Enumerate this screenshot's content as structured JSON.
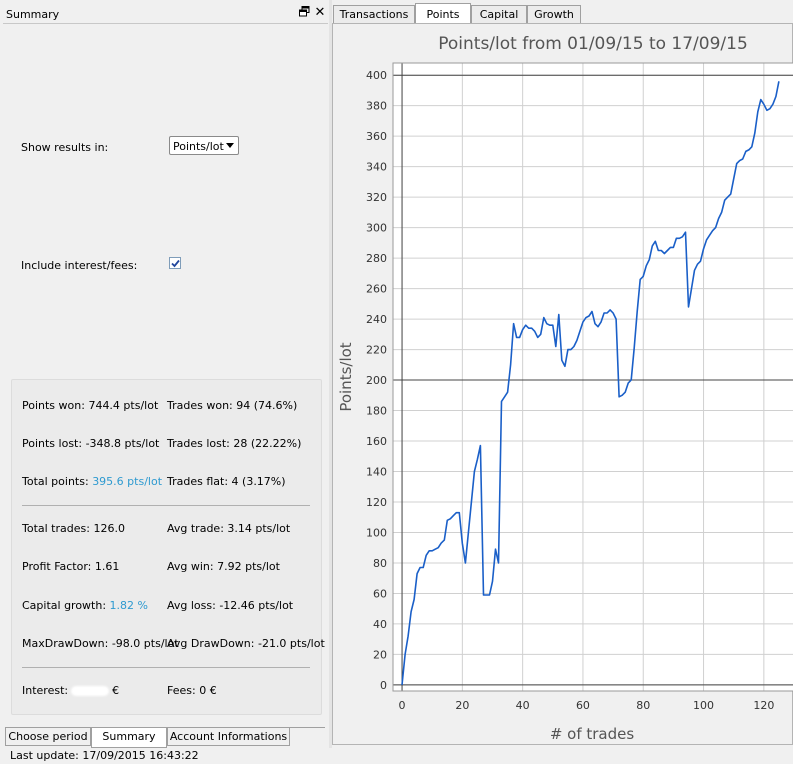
{
  "window": {
    "panel_title": "Summary",
    "status": "Last update: 17/09/2015 16:43:22"
  },
  "options": {
    "show_results_label": "Show results in:",
    "units_value": "Points/lot",
    "include_label": "Include interest/fees:",
    "include_checked": true
  },
  "stats": {
    "points_won": "Points won: 744.4 pts/lot",
    "points_lost": "Points lost: -348.8 pts/lot",
    "total_points_label": "Total points: ",
    "total_points_value": "395.6 pts/lot",
    "trades_won": "Trades won: 94 (74.6%)",
    "trades_lost": "Trades lost: 28 (22.22%)",
    "trades_flat": "Trades flat: 4 (3.17%)",
    "total_trades": "Total trades: 126.0",
    "profit_factor": "Profit Factor: 1.61",
    "capital_growth_label": "Capital growth: ",
    "capital_growth_value": "1.82 %",
    "max_drawdown": "MaxDrawDown: -98.0 pts/lot",
    "avg_trade": "Avg trade: 3.14 pts/lot",
    "avg_win": "Avg win: 7.92 pts/lot",
    "avg_loss": "Avg loss: -12.46 pts/lot",
    "avg_drawdown": "Avg DrawDown: -21.0 pts/lot",
    "interest_label": "Interest:",
    "interest_unit": "€",
    "fees": "Fees: 0 €"
  },
  "bottom_tabs": [
    "Choose period",
    "Summary",
    "Account Informations"
  ],
  "top_tabs": [
    "Transactions",
    "Points",
    "Capital",
    "Growth"
  ],
  "colors": {
    "line": "#1a5fc8",
    "highlight": "#2e9ad0"
  },
  "chart_data": {
    "type": "line",
    "title": "Points/lot from 01/09/15 to 17/09/15",
    "xlabel": "# of trades",
    "ylabel": "Points/lot",
    "xlim": [
      -3,
      130
    ],
    "ylim": [
      -4,
      408
    ],
    "xticks": [
      0,
      20,
      40,
      60,
      80,
      100,
      120
    ],
    "yticks": [
      0,
      20,
      40,
      60,
      80,
      100,
      120,
      140,
      160,
      180,
      200,
      220,
      240,
      260,
      280,
      300,
      320,
      340,
      360,
      380,
      400
    ],
    "grid": true,
    "reference_lines": [
      0,
      200,
      400
    ],
    "series": [
      {
        "values": [
          [
            0,
            0
          ],
          [
            1,
            20
          ],
          [
            2,
            32
          ],
          [
            3,
            48
          ],
          [
            4,
            56
          ],
          [
            5,
            73
          ],
          [
            6,
            77
          ],
          [
            7,
            77
          ],
          [
            8,
            85
          ],
          [
            9,
            88
          ],
          [
            10,
            88
          ],
          [
            11,
            89
          ],
          [
            12,
            90
          ],
          [
            13,
            93
          ],
          [
            14,
            95
          ],
          [
            15,
            108
          ],
          [
            16,
            109
          ],
          [
            17,
            111
          ],
          [
            18,
            113
          ],
          [
            19,
            113
          ],
          [
            20,
            93
          ],
          [
            21,
            80
          ],
          [
            22,
            100
          ],
          [
            23,
            120
          ],
          [
            24,
            140
          ],
          [
            25,
            148
          ],
          [
            26,
            157
          ],
          [
            27,
            59
          ],
          [
            28,
            59
          ],
          [
            29,
            59
          ],
          [
            30,
            68
          ],
          [
            31,
            89
          ],
          [
            32,
            80
          ],
          [
            33,
            186
          ],
          [
            34,
            189
          ],
          [
            35,
            192
          ],
          [
            36,
            210
          ],
          [
            37,
            237
          ],
          [
            38,
            228
          ],
          [
            39,
            228
          ],
          [
            40,
            233
          ],
          [
            41,
            236
          ],
          [
            42,
            234
          ],
          [
            43,
            234
          ],
          [
            44,
            232
          ],
          [
            45,
            228
          ],
          [
            46,
            230
          ],
          [
            47,
            241
          ],
          [
            48,
            237
          ],
          [
            49,
            236
          ],
          [
            50,
            236
          ],
          [
            51,
            222
          ],
          [
            52,
            243
          ],
          [
            53,
            213
          ],
          [
            54,
            209
          ],
          [
            55,
            220
          ],
          [
            56,
            220
          ],
          [
            57,
            222
          ],
          [
            58,
            226
          ],
          [
            59,
            232
          ],
          [
            60,
            238
          ],
          [
            61,
            241
          ],
          [
            62,
            242
          ],
          [
            63,
            245
          ],
          [
            64,
            237
          ],
          [
            65,
            235
          ],
          [
            66,
            238
          ],
          [
            67,
            244
          ],
          [
            68,
            244
          ],
          [
            69,
            246
          ],
          [
            70,
            244
          ],
          [
            71,
            240
          ],
          [
            72,
            189
          ],
          [
            73,
            190
          ],
          [
            74,
            192
          ],
          [
            75,
            198
          ],
          [
            76,
            200
          ],
          [
            77,
            221
          ],
          [
            78,
            245
          ],
          [
            79,
            266
          ],
          [
            80,
            268
          ],
          [
            81,
            275
          ],
          [
            82,
            279
          ],
          [
            83,
            288
          ],
          [
            84,
            291
          ],
          [
            85,
            285
          ],
          [
            86,
            285
          ],
          [
            87,
            283
          ],
          [
            88,
            285
          ],
          [
            89,
            287
          ],
          [
            90,
            287
          ],
          [
            91,
            293
          ],
          [
            92,
            293
          ],
          [
            93,
            294
          ],
          [
            94,
            297
          ],
          [
            95,
            248
          ],
          [
            96,
            260
          ],
          [
            97,
            272
          ],
          [
            98,
            276
          ],
          [
            99,
            278
          ],
          [
            100,
            286
          ],
          [
            101,
            292
          ],
          [
            102,
            295
          ],
          [
            103,
            298
          ],
          [
            104,
            300
          ],
          [
            105,
            306
          ],
          [
            106,
            310
          ],
          [
            107,
            318
          ],
          [
            108,
            320
          ],
          [
            109,
            322
          ],
          [
            110,
            332
          ],
          [
            111,
            342
          ],
          [
            112,
            344
          ],
          [
            113,
            345
          ],
          [
            114,
            350
          ],
          [
            115,
            351
          ],
          [
            116,
            353
          ],
          [
            117,
            362
          ],
          [
            118,
            376
          ],
          [
            119,
            384
          ],
          [
            120,
            381
          ],
          [
            121,
            377
          ],
          [
            122,
            378
          ],
          [
            123,
            381
          ],
          [
            124,
            386
          ],
          [
            125,
            396
          ]
        ]
      }
    ]
  }
}
